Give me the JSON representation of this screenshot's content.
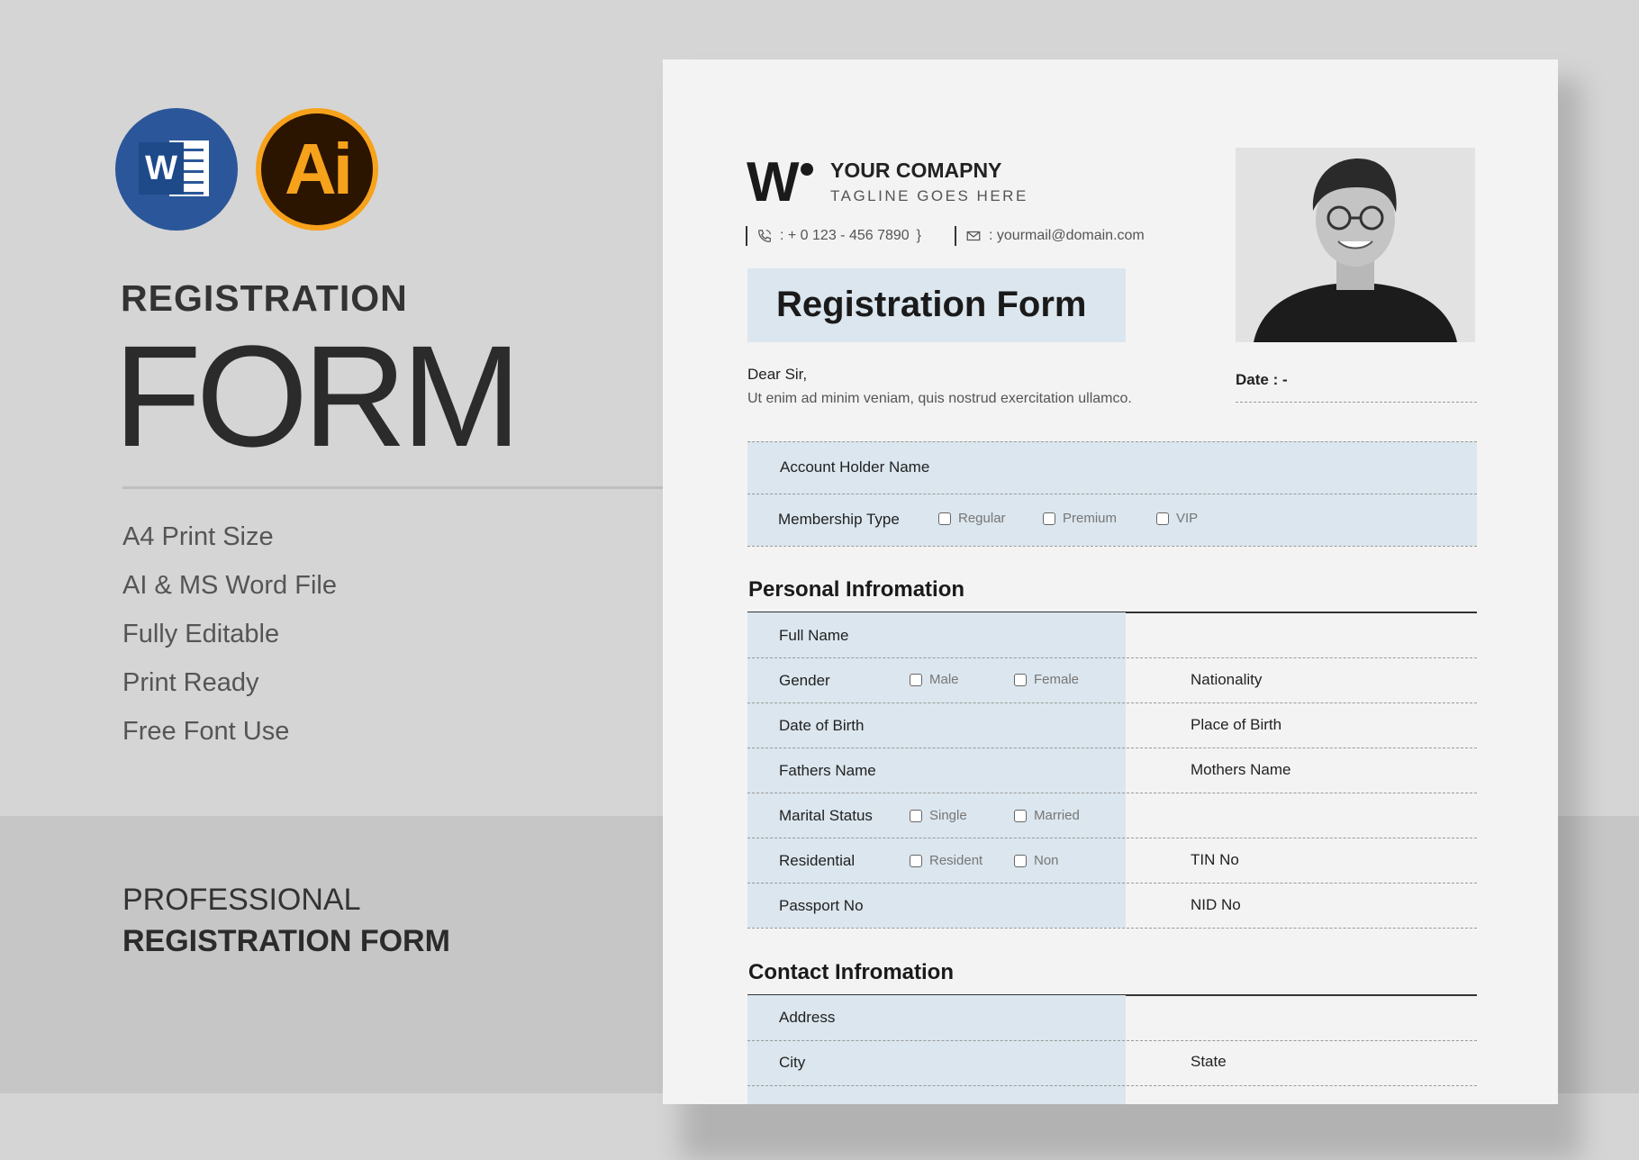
{
  "left": {
    "kicker": "REGISTRATION",
    "title": "FORM",
    "features": [
      "A4 Print Size",
      "AI & MS Word File",
      "Fully Editable",
      "Print Ready",
      "Free Font Use"
    ],
    "footer_line1": "PROFESSIONAL",
    "footer_line2": "REGISTRATION FORM",
    "icons": [
      "word-icon",
      "illustrator-icon"
    ],
    "word_letter": "W",
    "ai_letters": "Ai"
  },
  "doc": {
    "logo_letter": "W",
    "company": "YOUR COMAPNY",
    "tagline": "TAGLINE GOES HERE",
    "phone": ": + 0 123 - 456 7890",
    "email": ": yourmail@domain.com",
    "title": "Registration Form",
    "greeting": "Dear Sir,",
    "intro": "Ut enim ad minim veniam, quis nostrud exercitation ullamco.",
    "date_label": "Date : -",
    "account_holder": "Account Holder Name",
    "membership_type": "Membership Type",
    "membership_options": [
      "Regular",
      "Premium",
      "VIP"
    ],
    "personal_title": "Personal Infromation",
    "personal": {
      "full_name": "Full Name",
      "gender": "Gender",
      "gender_options": [
        "Male",
        "Female"
      ],
      "nationality": "Nationality",
      "dob": "Date of Birth",
      "place_of_birth": "Place of Birth",
      "father": "Fathers Name",
      "mother": "Mothers Name",
      "marital": "Marital Status",
      "marital_options": [
        "Single",
        "Married"
      ],
      "residential": "Residential",
      "residential_options": [
        "Resident",
        "Non"
      ],
      "tin": "TIN No",
      "passport": "Passport No",
      "nid": "NID No"
    },
    "contact_title": "Contact Infromation",
    "contact": {
      "address": "Address",
      "city": "City",
      "state": "State"
    }
  },
  "colors": {
    "background": "#d5d5d5",
    "band": "#c6c6c6",
    "paper": "#f3f3f3",
    "field_shade": "#dbe6ee",
    "word_blue": "#2b579a",
    "ai_orange": "#f7a21b"
  }
}
